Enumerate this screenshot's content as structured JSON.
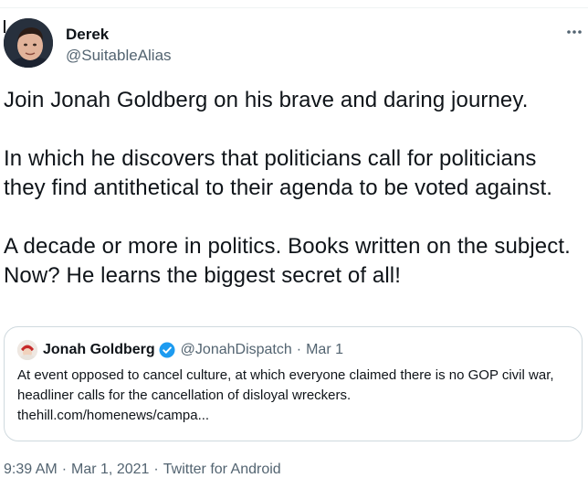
{
  "author": {
    "name": "Derek",
    "handle": "@SuitableAlias"
  },
  "tweet": {
    "text": "Join Jonah Goldberg on his brave and daring journey.\n\nIn which he discovers that politicians call for politicians they find antithetical to their agenda to be voted against.\n\nA decade or more in politics. Books written on the subject. Now? He learns the biggest secret of all!"
  },
  "quote": {
    "name": "Jonah Goldberg",
    "handle": "@JonahDispatch",
    "separator": "·",
    "date": "Mar 1",
    "text": "At event opposed to cancel culture, at which everyone claimed there is no GOP civil war, headliner calls for the cancellation of disloyal wreckers.\nthehill.com/homenews/campa..."
  },
  "meta": {
    "time": "9:39 AM",
    "separator": "·",
    "date": "Mar 1, 2021",
    "source": "Twitter for Android"
  },
  "icons": {
    "more": "more-horizontal-icon",
    "verified": "verified-badge-icon"
  },
  "colors": {
    "text": "#0f1419",
    "secondary": "#536471",
    "verified": "#1d9bf0",
    "border": "#cfd9de"
  }
}
